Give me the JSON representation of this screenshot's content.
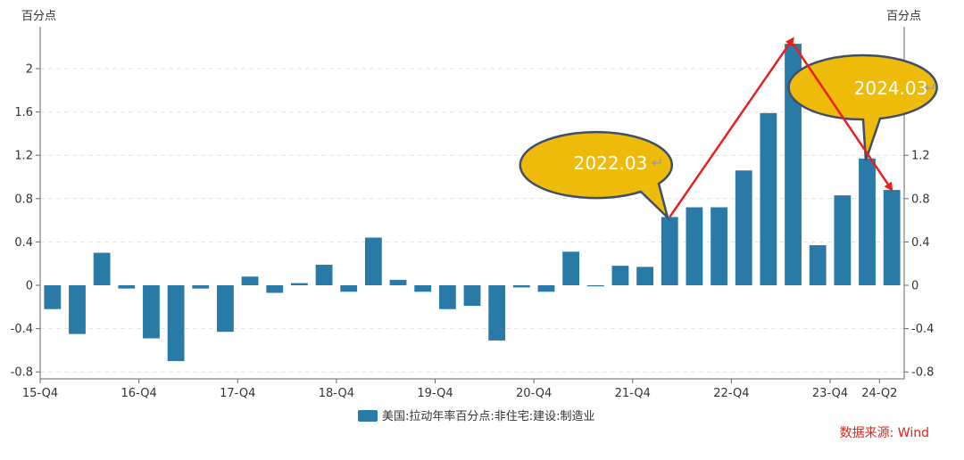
{
  "chart_data": {
    "type": "bar",
    "unit_left": "百分点",
    "unit_right": "百分点",
    "ylim": [
      -0.8,
      2.4
    ],
    "y_ticks": [
      "-0.8",
      "-0.4",
      "0",
      "0.4",
      "0.8",
      "1.2",
      "1.6",
      "2"
    ],
    "y_ticks_right": [
      "-0.8",
      "-0.4",
      "0",
      "0.4",
      "0.8",
      "1.2"
    ],
    "grid": true,
    "x_tick_labels": [
      "15-Q4",
      "16-Q4",
      "17-Q4",
      "18-Q4",
      "19-Q4",
      "20-Q4",
      "21-Q4",
      "22-Q4",
      "23-Q4",
      "24-Q2"
    ],
    "x_tick_positions": [
      0,
      4,
      8,
      12,
      16,
      20,
      24,
      28,
      32,
      34
    ],
    "series": [
      {
        "name": "美国:拉动年率百分点:非住宅:建设:制造业",
        "color": "#2a7aa8",
        "values": [
          -0.22,
          -0.45,
          0.3,
          -0.03,
          -0.49,
          -0.7,
          -0.03,
          -0.43,
          0.08,
          -0.07,
          0.02,
          0.19,
          -0.06,
          0.44,
          0.05,
          -0.06,
          -0.22,
          -0.19,
          -0.51,
          -0.02,
          -0.06,
          0.31,
          -0.01,
          0.18,
          0.17,
          0.63,
          0.72,
          0.72,
          1.06,
          1.59,
          2.23,
          0.37,
          0.83,
          1.17,
          0.88
        ]
      }
    ],
    "annotations": [
      {
        "text": "2022.03",
        "mark": "↵",
        "points_to_index": 25
      },
      {
        "text": "2024.03",
        "mark": "↵",
        "points_to_index": 33
      }
    ],
    "arrows": [
      {
        "from_index": 25,
        "to_index": 30,
        "color": "#e82020"
      },
      {
        "from_index": 30,
        "to_index": 34,
        "color": "#e82020"
      }
    ]
  },
  "source": "数据来源: Wind"
}
